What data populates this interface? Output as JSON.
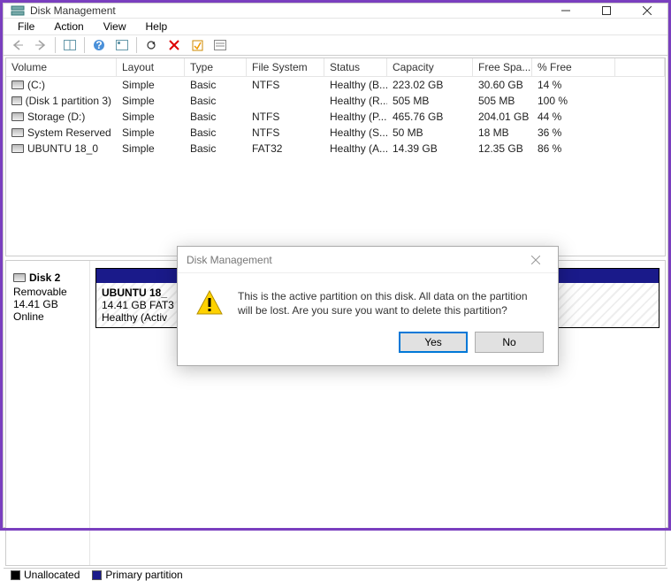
{
  "window": {
    "title": "Disk Management"
  },
  "menu": {
    "items": [
      "File",
      "Action",
      "View",
      "Help"
    ]
  },
  "columns": [
    "Volume",
    "Layout",
    "Type",
    "File System",
    "Status",
    "Capacity",
    "Free Spa...",
    "% Free"
  ],
  "volumes": [
    {
      "name": "(C:)",
      "layout": "Simple",
      "type": "Basic",
      "fs": "NTFS",
      "status": "Healthy (B...",
      "capacity": "223.02 GB",
      "free": "30.60 GB",
      "pct": "14 %"
    },
    {
      "name": "(Disk 1 partition 3)",
      "layout": "Simple",
      "type": "Basic",
      "fs": "",
      "status": "Healthy (R...",
      "capacity": "505 MB",
      "free": "505 MB",
      "pct": "100 %"
    },
    {
      "name": "Storage (D:)",
      "layout": "Simple",
      "type": "Basic",
      "fs": "NTFS",
      "status": "Healthy (P...",
      "capacity": "465.76 GB",
      "free": "204.01 GB",
      "pct": "44 %"
    },
    {
      "name": "System Reserved",
      "layout": "Simple",
      "type": "Basic",
      "fs": "NTFS",
      "status": "Healthy (S...",
      "capacity": "50 MB",
      "free": "18 MB",
      "pct": "36 %"
    },
    {
      "name": "UBUNTU 18_0",
      "layout": "Simple",
      "type": "Basic",
      "fs": "FAT32",
      "status": "Healthy (A...",
      "capacity": "14.39 GB",
      "free": "12.35 GB",
      "pct": "86 %"
    }
  ],
  "disk": {
    "label": "Disk 2",
    "media": "Removable",
    "size": "14.41 GB",
    "state": "Online",
    "partition": {
      "name": "UBUNTU 18_",
      "detail": "14.41 GB FAT3",
      "status": "Healthy (Activ"
    }
  },
  "legend": {
    "unallocated": "Unallocated",
    "primary": "Primary partition"
  },
  "dialog": {
    "title": "Disk Management",
    "message": "This is the active partition on this disk. All data on the partition will be lost. Are you sure you want to delete this partition?",
    "yes": "Yes",
    "no": "No"
  }
}
